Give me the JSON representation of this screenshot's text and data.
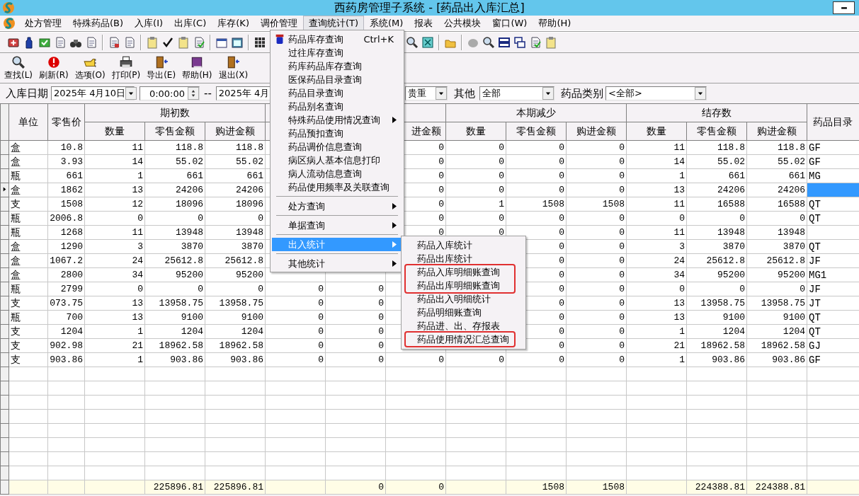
{
  "window": {
    "title": "西药房管理子系统 - [药品出入库汇总]"
  },
  "menu_bar": [
    {
      "label": "处方管理",
      "selected": false
    },
    {
      "label": "特殊药品(B)",
      "selected": false
    },
    {
      "label": "入库(I)",
      "selected": false
    },
    {
      "label": "出库(C)",
      "selected": false
    },
    {
      "label": "库存(K)",
      "selected": false
    },
    {
      "label": "调价管理",
      "selected": false
    },
    {
      "label": "查询统计(T)",
      "selected": true
    },
    {
      "label": "系统(M)",
      "selected": false
    },
    {
      "label": "报表",
      "selected": false
    },
    {
      "label": "公共模块",
      "selected": false
    },
    {
      "label": "窗口(W)",
      "selected": false
    },
    {
      "label": "帮助(H)",
      "selected": false
    }
  ],
  "toolbar_buttons": [
    "查找(L)",
    "刷新(R)",
    "选项(O)",
    "打印(P)",
    "导出(E)",
    "帮助(H)",
    "退出(X)"
  ],
  "filters": {
    "date_label": "入库日期",
    "start_date": "2025年 4月10日",
    "start_time": "0:00:00",
    "range_separator": "--",
    "end_date": "2025年 4月",
    "category_value": "贵重",
    "other_label": "其他",
    "other_value": "全部",
    "drug_type_label": "药品类别",
    "drug_type_value": "<全部>"
  },
  "table": {
    "header": {
      "unit": "单位",
      "price": "零售价",
      "groups": [
        {
          "title": "期初数",
          "columns": [
            "数量",
            "零售金额",
            "购进金额"
          ]
        },
        {
          "columns": [
            null,
            null,
            "进金额"
          ]
        },
        {
          "title": "本期减少",
          "columns": [
            "数量",
            "零售金额",
            "购进金额"
          ]
        },
        {
          "title": "结存数",
          "columns": [
            "数量",
            "零售金额",
            "购进金额"
          ]
        }
      ],
      "catalog": "药品目录"
    },
    "rows": [
      {
        "selected": false,
        "cells": [
          "盒",
          "10.8",
          "11",
          "118.8",
          "118.8",
          null,
          null,
          "0",
          "0",
          "0",
          "0",
          "11",
          "118.8",
          "118.8",
          "GF"
        ]
      },
      {
        "selected": false,
        "cells": [
          "盒",
          "3.93",
          "14",
          "55.02",
          "55.02",
          null,
          null,
          "0",
          "0",
          "0",
          "0",
          "14",
          "55.02",
          "55.02",
          "GF"
        ]
      },
      {
        "selected": false,
        "cells": [
          "瓶",
          "661",
          "1",
          "661",
          "661",
          null,
          null,
          "0",
          "0",
          "0",
          "0",
          "1",
          "661",
          "661",
          "MG"
        ]
      },
      {
        "selected": true,
        "cells": [
          "盒",
          "1862",
          "13",
          "24206",
          "24206",
          null,
          null,
          "0",
          "0",
          "0",
          "0",
          "13",
          "24206",
          "24206",
          null
        ]
      },
      {
        "selected": false,
        "cells": [
          "支",
          "1508",
          "12",
          "18096",
          "18096",
          null,
          null,
          "0",
          "1",
          "1508",
          "1508",
          "11",
          "16588",
          "16588",
          "QT"
        ]
      },
      {
        "selected": false,
        "cells": [
          "瓶",
          "2006.8",
          "0",
          "0",
          "0",
          null,
          null,
          "0",
          "0",
          "0",
          "0",
          "0",
          "0",
          "0",
          "QT"
        ]
      },
      {
        "selected": false,
        "cells": [
          "瓶",
          "1268",
          "11",
          "13948",
          "13948",
          null,
          null,
          "0",
          "0",
          "0",
          "0",
          "11",
          "13948",
          "13948",
          null
        ]
      },
      {
        "selected": false,
        "cells": [
          "盒",
          "1290",
          "3",
          "3870",
          "3870",
          null,
          null,
          null,
          null,
          "0",
          "0",
          "3",
          "3870",
          "3870",
          "QT"
        ]
      },
      {
        "selected": false,
        "cells": [
          "盒",
          "1067.2",
          "24",
          "25612.8",
          "25612.8",
          null,
          null,
          null,
          null,
          "0",
          "0",
          "24",
          "25612.8",
          "25612.8",
          "JF"
        ]
      },
      {
        "selected": false,
        "cells": [
          "盒",
          "2800",
          "34",
          "95200",
          "95200",
          null,
          null,
          null,
          null,
          "0",
          "0",
          "34",
          "95200",
          "95200",
          "MG1"
        ]
      },
      {
        "selected": false,
        "cells": [
          "瓶",
          "2799",
          "0",
          "0",
          "0",
          "0",
          "0",
          null,
          null,
          "0",
          "0",
          "0",
          "0",
          "0",
          "JF"
        ]
      },
      {
        "selected": false,
        "cells": [
          "支",
          "073.75",
          "13",
          "13958.75",
          "13958.75",
          "0",
          "0",
          null,
          null,
          "0",
          "0",
          "13",
          "13958.75",
          "13958.75",
          "JT"
        ]
      },
      {
        "selected": false,
        "cells": [
          "瓶",
          "700",
          "13",
          "9100",
          "9100",
          "0",
          "0",
          null,
          null,
          "0",
          "0",
          "13",
          "9100",
          "9100",
          "QT"
        ]
      },
      {
        "selected": false,
        "cells": [
          "支",
          "1204",
          "1",
          "1204",
          "1204",
          "0",
          "0",
          null,
          null,
          "0",
          "0",
          "1",
          "1204",
          "1204",
          "QT"
        ]
      },
      {
        "selected": false,
        "cells": [
          "支",
          "902.98",
          "21",
          "18962.58",
          "18962.58",
          "0",
          "0",
          null,
          null,
          "0",
          "0",
          "21",
          "18962.58",
          "18962.58",
          "GJ"
        ]
      },
      {
        "selected": false,
        "cells": [
          "支",
          "903.86",
          "1",
          "903.86",
          "903.86",
          "0",
          "0",
          "0",
          "0",
          "0",
          "0",
          "1",
          "903.86",
          "903.86",
          "GF"
        ]
      }
    ],
    "totals": {
      "opening_retail_amount": "225896.81",
      "opening_purchase_amount": "225896.81",
      "column_8": "0",
      "column_9": "0",
      "decrease_retail_amount": "1508",
      "decrease_purchase_amount": "1508",
      "closing_retail_amount": "224388.81",
      "closing_purchase_amount": "224388.81"
    }
  },
  "query_menu": {
    "groups": [
      [
        {
          "label": "药品库存查询",
          "shortcut": "Ctrl+K",
          "has_submenu": false,
          "selected": false
        },
        {
          "label": "过往库存查询",
          "has_submenu": false,
          "selected": false
        },
        {
          "label": "药库药品库存查询",
          "has_submenu": false,
          "selected": false
        },
        {
          "label": "医保药品目录查询",
          "has_submenu": false,
          "selected": false
        },
        {
          "label": "药品目录查询",
          "has_submenu": false,
          "selected": false
        },
        {
          "label": "药品别名查询",
          "has_submenu": false,
          "selected": false
        },
        {
          "label": "特殊药品使用情况查询",
          "has_submenu": true,
          "selected": false
        },
        {
          "label": "药品预扣查询",
          "has_submenu": false,
          "selected": false
        },
        {
          "label": "药品调价信息查询",
          "has_submenu": false,
          "selected": false
        },
        {
          "label": "病区病人基本信息打印",
          "has_submenu": false,
          "selected": false
        },
        {
          "label": "病人流动信息查询",
          "has_submenu": false,
          "selected": false
        },
        {
          "label": "药品使用频率及关联查询",
          "has_submenu": false,
          "selected": false
        }
      ],
      [
        {
          "label": "处方查询",
          "has_submenu": true,
          "selected": false
        }
      ],
      [
        {
          "label": "单据查询",
          "has_submenu": true,
          "selected": false
        }
      ],
      [
        {
          "label": "出入统计",
          "has_submenu": true,
          "selected": true
        }
      ],
      [
        {
          "label": "其他统计",
          "has_submenu": true,
          "selected": false
        }
      ]
    ]
  },
  "submenu": {
    "items": [
      {
        "label": "药品入库统计",
        "highlighted": false,
        "selected": false
      },
      {
        "label": "药品出库统计",
        "highlighted": false,
        "selected": false
      },
      {
        "label": "药品入库明细账查询",
        "highlighted": true,
        "selected": false
      },
      {
        "label": "药品出库明细账查询",
        "highlighted": true,
        "selected": false
      },
      {
        "label": "药品出入明细统计",
        "highlighted": false,
        "selected": false
      },
      {
        "label": "药品明细账查询",
        "highlighted": false,
        "selected": false
      },
      {
        "label": "药品进、出、存报表",
        "highlighted": false,
        "selected": false
      },
      {
        "label": "药品使用情况汇总查询",
        "highlighted": true,
        "selected": false
      }
    ]
  }
}
